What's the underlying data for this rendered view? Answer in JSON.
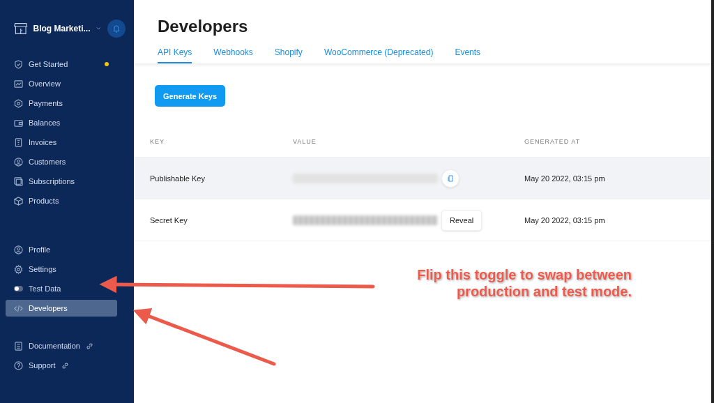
{
  "sidebar": {
    "brand": "Blog Marketi...",
    "items": [
      {
        "kind": "nav",
        "label": "Get Started",
        "dot": true,
        "selected": false
      },
      {
        "kind": "nav",
        "label": "Overview",
        "dot": false,
        "selected": false
      },
      {
        "kind": "nav",
        "label": "Payments",
        "dot": false,
        "selected": false
      },
      {
        "kind": "nav",
        "label": "Balances",
        "dot": false,
        "selected": false
      },
      {
        "kind": "nav",
        "label": "Invoices",
        "dot": false,
        "selected": false
      },
      {
        "kind": "nav",
        "label": "Customers",
        "dot": false,
        "selected": false
      },
      {
        "kind": "nav",
        "label": "Subscriptions",
        "dot": false,
        "selected": false
      },
      {
        "kind": "nav",
        "label": "Products",
        "dot": false,
        "selected": false
      }
    ],
    "bottom_items": [
      {
        "kind": "nav",
        "label": "Profile",
        "selected": false
      },
      {
        "kind": "nav",
        "label": "Settings",
        "selected": false
      },
      {
        "kind": "toggle",
        "label": "Test Data",
        "on": false,
        "selected": false
      },
      {
        "kind": "nav",
        "label": "Developers",
        "selected": true
      }
    ],
    "links": [
      {
        "label": "Documentation"
      },
      {
        "label": "Support"
      }
    ]
  },
  "page": {
    "title": "Developers",
    "tabs": [
      {
        "label": "API Keys",
        "selected": true
      },
      {
        "label": "Webhooks",
        "selected": false
      },
      {
        "label": "Shopify",
        "selected": false
      },
      {
        "label": "WooCommerce (Deprecated)",
        "selected": false
      },
      {
        "label": "Events",
        "selected": false
      }
    ],
    "generate_button": "Generate Keys",
    "table": {
      "columns": [
        "KEY",
        "VALUE",
        "GENERATED AT"
      ],
      "rows": [
        {
          "kind": "copy",
          "key": "Publishable Key",
          "generated_at": "May 20 2022, 03:15 pm",
          "highlighted": true
        },
        {
          "kind": "reveal",
          "key": "Secret Key",
          "action_label": "Reveal",
          "generated_at": "May 20 2022, 03:15 pm",
          "highlighted": false
        }
      ]
    }
  },
  "annotation": {
    "lines": [
      "Flip this toggle to swap between",
      "production and test mode."
    ]
  }
}
